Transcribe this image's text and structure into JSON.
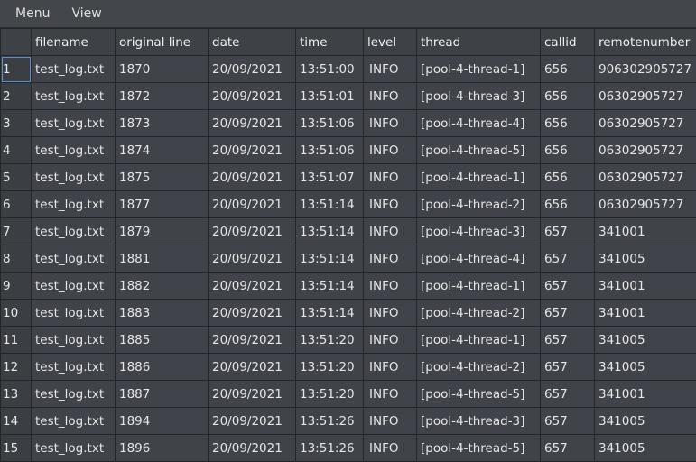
{
  "menu": {
    "items": [
      "Menu",
      "View"
    ]
  },
  "table": {
    "columns": [
      "",
      "filename",
      "original line",
      "date",
      "time",
      "level",
      "thread",
      "callid",
      "remotenumber"
    ],
    "rows": [
      [
        "1",
        "test_log.txt",
        "1870",
        "20/09/2021",
        "13:51:00",
        "INFO",
        "[pool-4-thread-1]",
        "656",
        "906302905727"
      ],
      [
        "2",
        "test_log.txt",
        "1872",
        "20/09/2021",
        "13:51:01",
        "INFO",
        "[pool-4-thread-3]",
        "656",
        "06302905727"
      ],
      [
        "3",
        "test_log.txt",
        "1873",
        "20/09/2021",
        "13:51:06",
        "INFO",
        "[pool-4-thread-4]",
        "656",
        "06302905727"
      ],
      [
        "4",
        "test_log.txt",
        "1874",
        "20/09/2021",
        "13:51:06",
        "INFO",
        "[pool-4-thread-5]",
        "656",
        "06302905727"
      ],
      [
        "5",
        "test_log.txt",
        "1875",
        "20/09/2021",
        "13:51:07",
        "INFO",
        "[pool-4-thread-1]",
        "656",
        "06302905727"
      ],
      [
        "6",
        "test_log.txt",
        "1877",
        "20/09/2021",
        "13:51:14",
        "INFO",
        "[pool-4-thread-2]",
        "656",
        "06302905727"
      ],
      [
        "7",
        "test_log.txt",
        "1879",
        "20/09/2021",
        "13:51:14",
        "INFO",
        "[pool-4-thread-3]",
        "657",
        "341001"
      ],
      [
        "8",
        "test_log.txt",
        "1881",
        "20/09/2021",
        "13:51:14",
        "INFO",
        "[pool-4-thread-4]",
        "657",
        "341005"
      ],
      [
        "9",
        "test_log.txt",
        "1882",
        "20/09/2021",
        "13:51:14",
        "INFO",
        "[pool-4-thread-1]",
        "657",
        "341001"
      ],
      [
        "10",
        "test_log.txt",
        "1883",
        "20/09/2021",
        "13:51:14",
        "INFO",
        "[pool-4-thread-2]",
        "657",
        "341001"
      ],
      [
        "11",
        "test_log.txt",
        "1885",
        "20/09/2021",
        "13:51:20",
        "INFO",
        "[pool-4-thread-1]",
        "657",
        "341005"
      ],
      [
        "12",
        "test_log.txt",
        "1886",
        "20/09/2021",
        "13:51:20",
        "INFO",
        "[pool-4-thread-2]",
        "657",
        "341005"
      ],
      [
        "13",
        "test_log.txt",
        "1887",
        "20/09/2021",
        "13:51:20",
        "INFO",
        "[pool-4-thread-5]",
        "657",
        "341001"
      ],
      [
        "14",
        "test_log.txt",
        "1894",
        "20/09/2021",
        "13:51:26",
        "INFO",
        "[pool-4-thread-3]",
        "657",
        "341005"
      ],
      [
        "15",
        "test_log.txt",
        "1896",
        "20/09/2021",
        "13:51:26",
        "INFO",
        "[pool-4-thread-5]",
        "657",
        "341005"
      ]
    ]
  }
}
